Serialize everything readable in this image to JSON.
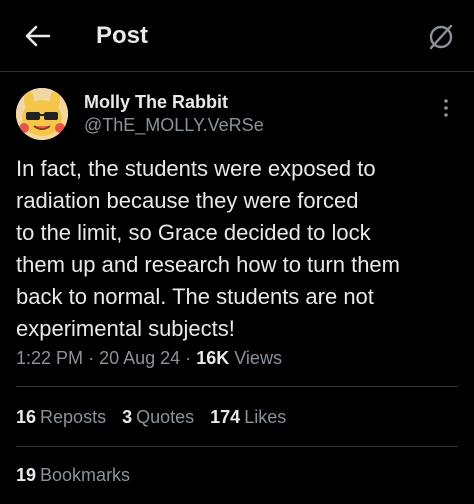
{
  "header": {
    "title": "Post",
    "back_icon": "arrow-left-icon",
    "grok_icon": "grok-icon"
  },
  "author": {
    "display_name": "Molly The Rabbit",
    "handle": "@ThE_MOLLY.VeRSe",
    "avatar_icon": "avatar-cartoon"
  },
  "post": {
    "text": "In fact, the students were exposed to\nradiation because they were forced\nto the limit, so Grace decided to lock\nthem up and research how to turn them\nback to normal. The students are not\nexperimental subjects!",
    "time": "1:22 PM",
    "separator": "·",
    "date": "20 Aug 24",
    "views_count": "16K",
    "views_label": "Views"
  },
  "stats": {
    "reposts_count": "16",
    "reposts_label": "Reposts",
    "quotes_count": "3",
    "quotes_label": "Quotes",
    "likes_count": "174",
    "likes_label": "Likes",
    "bookmarks_count": "19",
    "bookmarks_label": "Bookmarks"
  },
  "colors": {
    "background": "#000000",
    "text": "#e7e9ea",
    "muted": "#8b9299",
    "divider": "#2f3336"
  }
}
